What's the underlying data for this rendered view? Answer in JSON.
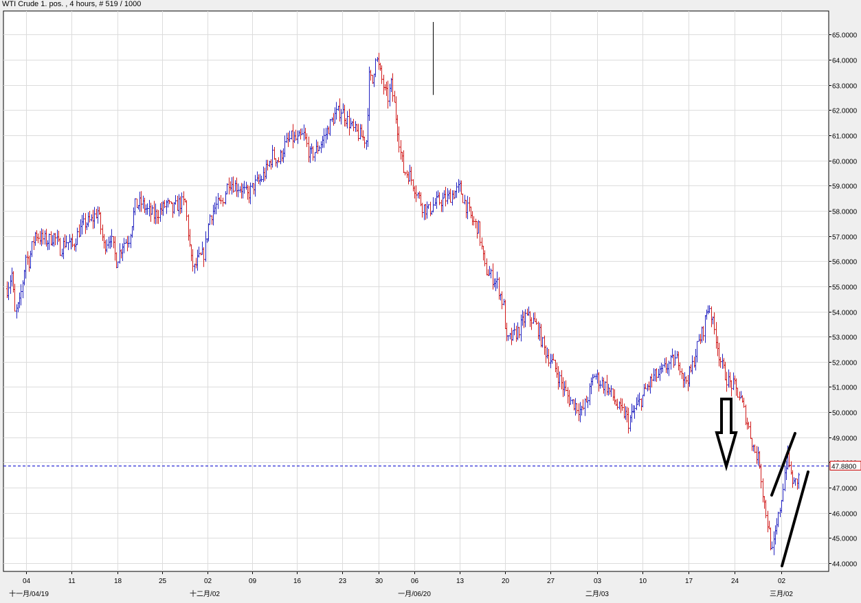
{
  "header": {
    "title": "WTI Crude 1. pos. , 4 hours, # 519 / 1000"
  },
  "colors": {
    "up": "#2020c0",
    "down": "#d01818",
    "current_line": "#0000cc",
    "current_label_border": "#cc0000"
  },
  "chart_data": {
    "type": "ohlc",
    "title": "WTI Crude 1. pos. , 4 hours, # 519 / 1000",
    "ylim": [
      43.8,
      65.5
    ],
    "y_ticks": [
      44,
      45,
      46,
      47,
      48,
      49,
      50,
      51,
      52,
      53,
      54,
      55,
      56,
      57,
      58,
      59,
      60,
      61,
      62,
      63,
      64,
      65
    ],
    "y_tick_labels": [
      "44.0000",
      "45.0000",
      "46.0000",
      "47.0000",
      "48.0000",
      "49.0000",
      "50.0000",
      "51.0000",
      "52.0000",
      "53.0000",
      "54.0000",
      "55.0000",
      "56.0000",
      "57.0000",
      "58.0000",
      "59.0000",
      "60.0000",
      "61.0000",
      "62.0000",
      "63.0000",
      "64.0000",
      "65.0000"
    ],
    "x_tick_labels": [
      "04",
      "11",
      "18",
      "25",
      "02",
      "09",
      "16",
      "23",
      "30",
      "06",
      "13",
      "20",
      "27",
      "03",
      "10",
      "17",
      "24",
      "02"
    ],
    "x_tick_index": [
      7,
      24,
      41,
      58,
      75,
      92,
      109,
      126,
      143,
      153,
      170,
      187,
      204,
      221,
      238,
      255,
      272,
      289
    ],
    "x_month_labels": [
      {
        "label": "十一月/04/19",
        "index": 0
      },
      {
        "label": "十二月/02",
        "index": 75
      },
      {
        "label": "一月/06/20",
        "index": 153
      },
      {
        "label": "二月/03",
        "index": 221
      },
      {
        "label": "三月/02",
        "index": 289
      }
    ],
    "grid": true,
    "current_price": 47.88,
    "current_price_label": "47.8800",
    "anchors": [
      [
        0,
        54.9
      ],
      [
        3,
        55.5
      ],
      [
        5,
        53.9
      ],
      [
        8,
        54.3
      ],
      [
        10,
        55.2
      ],
      [
        12,
        56.2
      ],
      [
        14,
        56.0
      ],
      [
        18,
        57.1
      ],
      [
        22,
        56.9
      ],
      [
        26,
        56.8
      ],
      [
        30,
        57.0
      ],
      [
        34,
        56.5
      ],
      [
        38,
        56.8
      ],
      [
        42,
        56.6
      ],
      [
        46,
        57.2
      ],
      [
        50,
        57.5
      ],
      [
        54,
        57.6
      ],
      [
        58,
        58.0
      ],
      [
        62,
        56.6
      ],
      [
        66,
        57.0
      ],
      [
        70,
        56.0
      ],
      [
        74,
        56.7
      ],
      [
        78,
        56.9
      ],
      [
        82,
        58.2
      ],
      [
        86,
        58.3
      ],
      [
        90,
        58.0
      ],
      [
        94,
        57.8
      ],
      [
        98,
        58.0
      ],
      [
        100,
        58.1
      ],
      [
        102,
        58.3
      ],
      [
        106,
        58.0
      ],
      [
        110,
        58.3
      ],
      [
        114,
        58.3
      ],
      [
        118,
        56.0
      ],
      [
        120,
        55.7
      ],
      [
        122,
        56.0
      ],
      [
        126,
        56.3
      ],
      [
        130,
        57.8
      ],
      [
        134,
        58.2
      ],
      [
        138,
        58.3
      ],
      [
        142,
        59.2
      ],
      [
        146,
        59.0
      ],
      [
        150,
        58.9
      ],
      [
        154,
        58.6
      ],
      [
        158,
        59.0
      ],
      [
        162,
        59.2
      ],
      [
        166,
        59.6
      ],
      [
        170,
        60.2
      ],
      [
        174,
        60.0
      ],
      [
        178,
        60.6
      ],
      [
        182,
        60.9
      ],
      [
        186,
        60.8
      ],
      [
        190,
        61.0
      ],
      [
        194,
        60.2
      ],
      [
        198,
        60.4
      ],
      [
        202,
        60.8
      ],
      [
        206,
        61.3
      ],
      [
        210,
        61.8
      ],
      [
        214,
        62.0
      ],
      [
        218,
        61.6
      ],
      [
        222,
        61.2
      ],
      [
        226,
        61.0
      ],
      [
        230,
        60.8
      ],
      [
        232,
        63.3
      ],
      [
        234,
        63.1
      ],
      [
        236,
        64.2
      ],
      [
        238,
        63.7
      ],
      [
        240,
        63.2
      ],
      [
        242,
        62.7
      ],
      [
        244,
        62.5
      ],
      [
        246,
        63.0
      ],
      [
        248,
        62.2
      ],
      [
        250,
        61.3
      ],
      [
        252,
        60.3
      ],
      [
        254,
        59.6
      ],
      [
        258,
        59.4
      ],
      [
        262,
        58.8
      ],
      [
        266,
        58.2
      ],
      [
        270,
        58.0
      ],
      [
        274,
        58.3
      ],
      [
        278,
        58.4
      ],
      [
        282,
        58.5
      ],
      [
        286,
        58.7
      ],
      [
        290,
        58.9
      ],
      [
        294,
        58.2
      ],
      [
        298,
        57.6
      ],
      [
        302,
        57.3
      ],
      [
        306,
        55.7
      ],
      [
        310,
        55.4
      ],
      [
        314,
        55.1
      ],
      [
        318,
        54.2
      ],
      [
        320,
        52.8
      ],
      [
        324,
        53.0
      ],
      [
        328,
        53.3
      ],
      [
        332,
        53.8
      ],
      [
        336,
        53.7
      ],
      [
        340,
        53.3
      ],
      [
        344,
        52.5
      ],
      [
        348,
        52.1
      ],
      [
        352,
        51.6
      ],
      [
        356,
        51.0
      ],
      [
        360,
        50.5
      ],
      [
        364,
        50.3
      ],
      [
        368,
        50.0
      ],
      [
        372,
        50.6
      ],
      [
        376,
        51.5
      ],
      [
        380,
        51.2
      ],
      [
        384,
        51.0
      ],
      [
        388,
        50.6
      ],
      [
        392,
        50.1
      ],
      [
        396,
        49.9
      ],
      [
        398,
        49.6
      ],
      [
        402,
        50.1
      ],
      [
        406,
        50.5
      ],
      [
        410,
        51.0
      ],
      [
        414,
        51.4
      ],
      [
        418,
        51.5
      ],
      [
        422,
        51.8
      ],
      [
        426,
        52.0
      ],
      [
        430,
        52.1
      ],
      [
        434,
        51.2
      ],
      [
        438,
        51.6
      ],
      [
        442,
        52.6
      ],
      [
        446,
        53.3
      ],
      [
        448,
        54.0
      ],
      [
        450,
        54.2
      ],
      [
        452,
        53.5
      ],
      [
        454,
        53.0
      ],
      [
        456,
        52.3
      ],
      [
        458,
        51.8
      ],
      [
        462,
        51.2
      ],
      [
        466,
        51.0
      ],
      [
        470,
        50.5
      ],
      [
        474,
        49.6
      ],
      [
        478,
        48.6
      ],
      [
        482,
        48.0
      ],
      [
        484,
        46.8
      ],
      [
        486,
        46.0
      ],
      [
        488,
        45.2
      ],
      [
        490,
        44.4
      ],
      [
        492,
        45.1
      ],
      [
        494,
        45.8
      ],
      [
        496,
        46.6
      ],
      [
        498,
        47.6
      ],
      [
        500,
        48.3
      ],
      [
        502,
        47.5
      ],
      [
        504,
        47.1
      ],
      [
        507,
        47.4
      ]
    ]
  }
}
